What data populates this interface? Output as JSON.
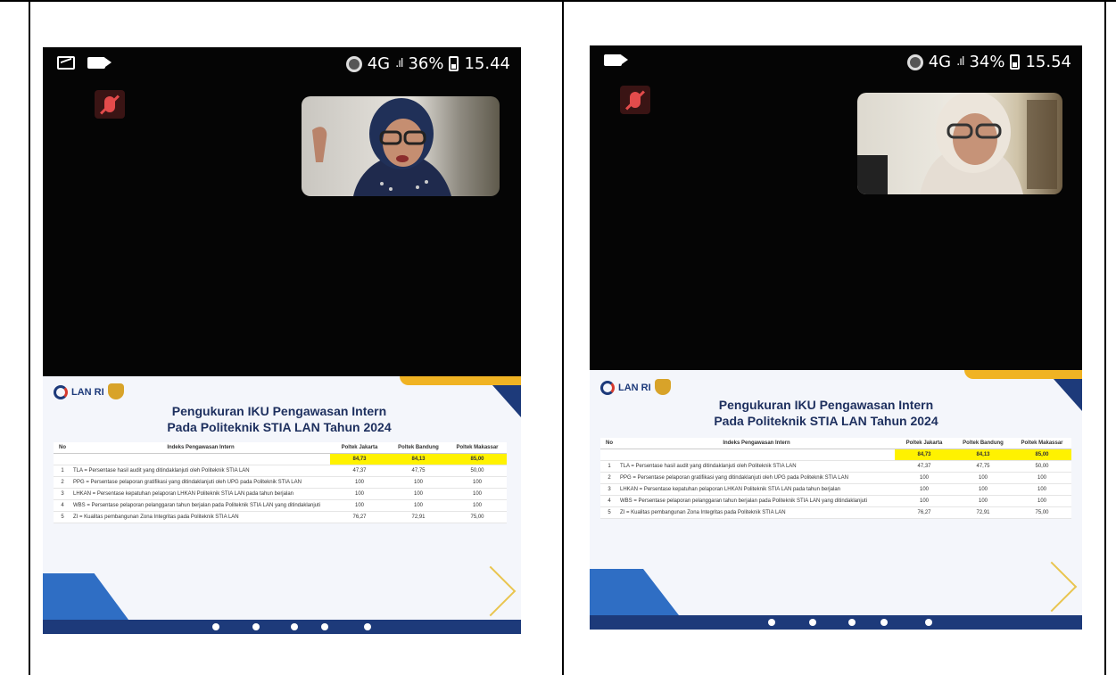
{
  "panels": [
    {
      "status": {
        "network": "4G",
        "signal": ".ıl",
        "battery": "36%",
        "time": "15.44"
      },
      "slide": {
        "logo": "LAN RI",
        "title_line1": "Pengukuran IKU Pengawasan Intern",
        "title_line2": "Pada Politeknik STIA LAN Tahun 2024"
      }
    },
    {
      "status": {
        "network": "4G",
        "signal": ".ıl",
        "battery": "34%",
        "time": "15.54"
      },
      "slide": {
        "logo": "LAN RI",
        "title_line1": "Pengukuran IKU Pengawasan Intern",
        "title_line2": "Pada Politeknik STIA LAN Tahun 2024"
      }
    }
  ],
  "table": {
    "headers": [
      "No",
      "Indeks Pengawasan Intern",
      "Poltek Jakarta",
      "Poltek Bandung",
      "Poltek Makassar"
    ],
    "totals": [
      "84,73",
      "84,13",
      "85,00"
    ],
    "rows": [
      {
        "no": "1",
        "label": "TLA   = Persentase hasil audit yang ditindaklanjuti oleh Politeknik STIA LAN",
        "v1": "47,37",
        "v2": "47,75",
        "v3": "50,00"
      },
      {
        "no": "2",
        "label": "PPG   = Persentase pelaporan gratifikasi yang ditindaklanjuti oleh UPG pada Politeknik STIA LAN",
        "v1": "100",
        "v2": "100",
        "v3": "100"
      },
      {
        "no": "3",
        "label": "LHKAN = Persentase kepatuhan pelaporan LHKAN Politeknik STIA LAN pada tahun berjalan",
        "v1": "100",
        "v2": "100",
        "v3": "100"
      },
      {
        "no": "4",
        "label": "WBS   = Persentase pelaporan pelanggaran tahun berjalan pada Politeknik STIA LAN yang ditindaklanjuti",
        "v1": "100",
        "v2": "100",
        "v3": "100"
      },
      {
        "no": "5",
        "label": "ZI    = Kualitas pembangunan Zona Integritas pada Politeknik STIA LAN",
        "v1": "76,27",
        "v2": "72,91",
        "v3": "75,00"
      }
    ]
  },
  "colors": {
    "navy": "#1d3a7a",
    "gold": "#f0b323",
    "highlight": "#fff200",
    "phone_bg": "#050505"
  }
}
